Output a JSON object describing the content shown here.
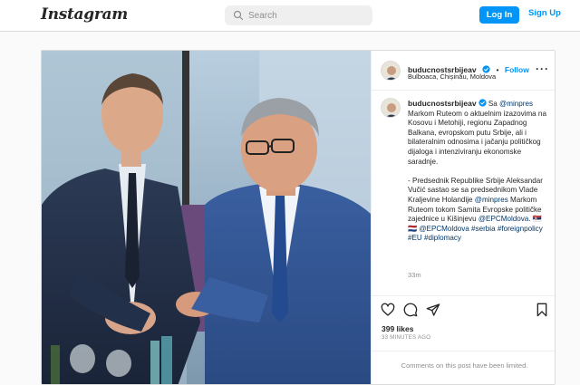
{
  "topbar": {
    "logo": "Instagram",
    "search_placeholder": "Search",
    "login_label": "Log In",
    "signup_label": "Sign Up"
  },
  "post": {
    "username": "buducnostsrbijeav",
    "follow_label": "Follow",
    "location": "Bulboaca, Chișinău, Moldova",
    "caption": {
      "p1_prefix": "Sa ",
      "p1_mention": "@minpres",
      "p1_text": " Markom Ruteom o aktuelnim izazovima na Kosovu i Metohiji, regionu Zapadnog Balkana, evropskom putu Srbije, ali i bilateralnim odnosima i jačanju političkog dijaloga i intenziviranju ekonomske saradnje.",
      "p2_text": "- Predsednik Republike Srbije Aleksandar Vučić sastao se sa predsednikom Vlade Kraljevine Holandije ",
      "p2_mention": "@minpres",
      "p2_text2": " Markom Ruteom tokom Samita Evropske političke zajednice u Kišinjevu ",
      "p2_mention2": "@EPCMoldova",
      "p2_text3": ". 🇷🇸 🇳🇱 ",
      "p2_mention3": "@EPCMoldova",
      "p2_tag1": "#serbia",
      "p2_tag2": "#foreignpolicy",
      "p2_tag3": "#EU",
      "p2_tag4": "#diplomacy"
    },
    "caption_time": "33m",
    "likes": "399 likes",
    "time_ago": "33 MINUTES AGO",
    "comments_limited": "Comments on this post have been limited."
  },
  "colors": {
    "accent": "#0095f6",
    "link": "#00376b",
    "muted": "#8e8e8e",
    "border": "#dbdbdb"
  },
  "icons": [
    "search-icon",
    "verified-badge-icon",
    "more-options-icon",
    "heart-icon",
    "comment-icon",
    "share-icon",
    "bookmark-icon"
  ]
}
